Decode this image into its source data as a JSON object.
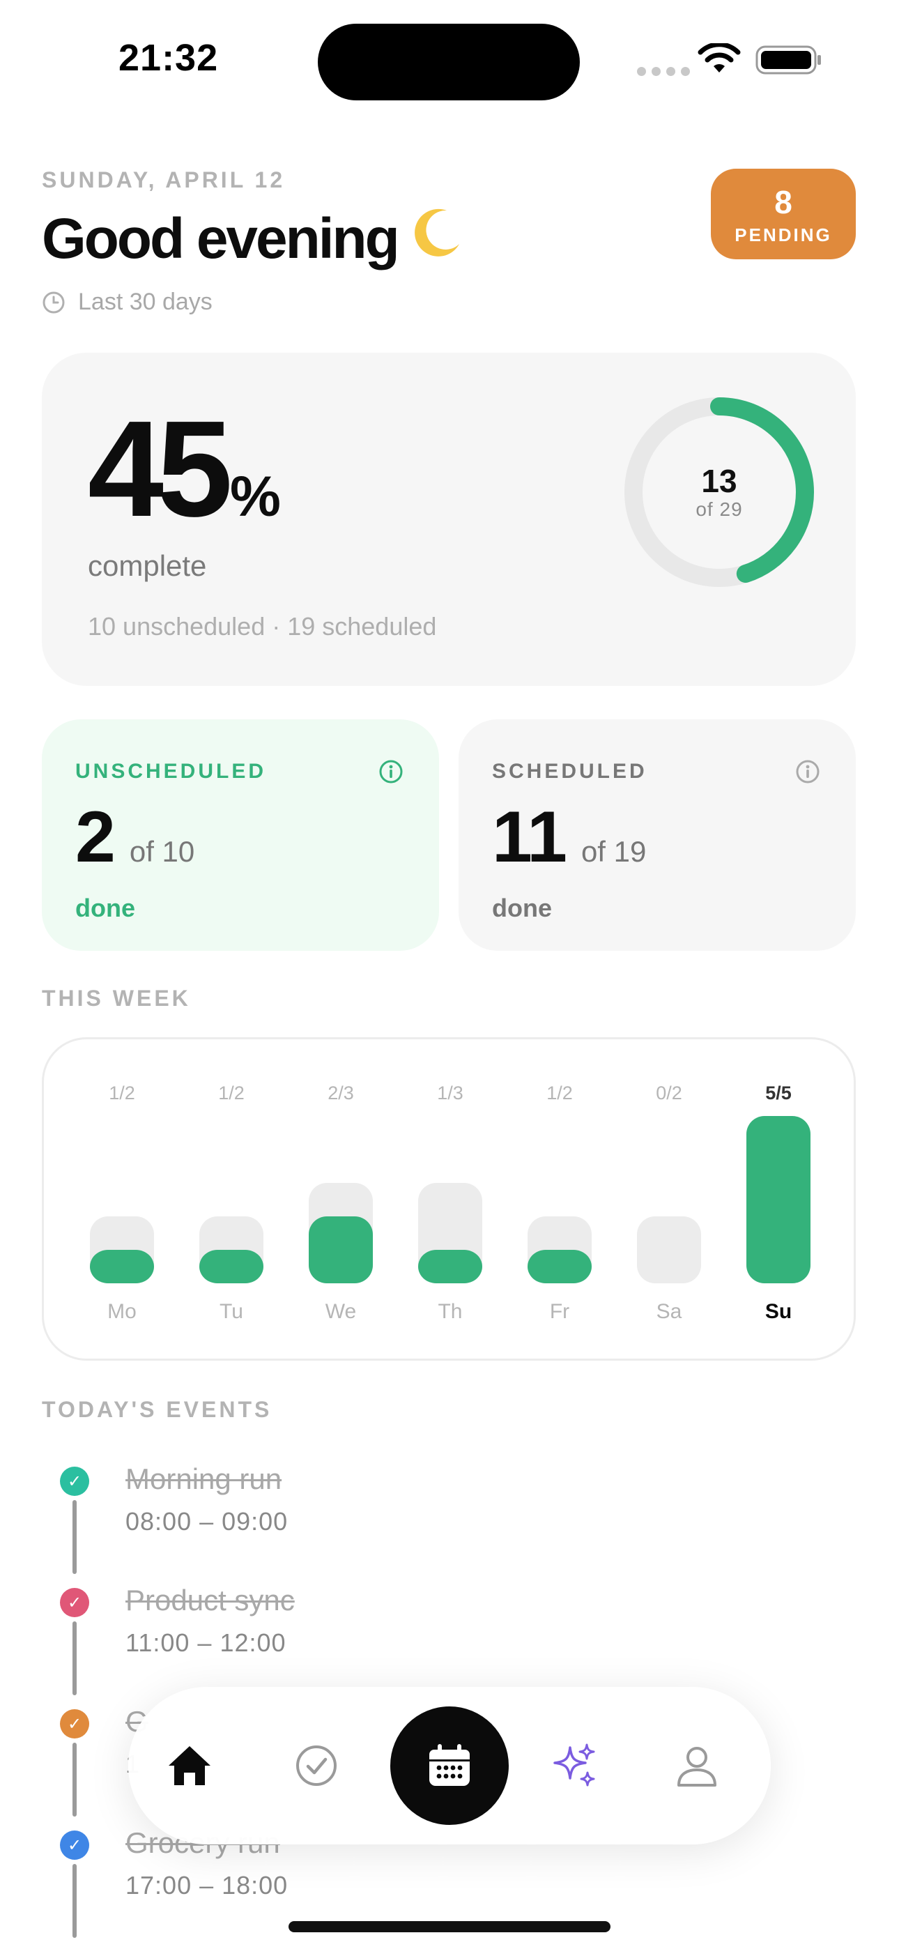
{
  "status_bar": {
    "time": "21:32"
  },
  "header": {
    "date": "SUNDAY, APRIL 12",
    "greeting": "Good evening",
    "range": "Last 30 days",
    "pending_count": "8",
    "pending_label": "PENDING"
  },
  "progress": {
    "percent": "45",
    "percent_sign": "%",
    "complete_label": "complete",
    "breakdown": "10 unscheduled  ·  19 scheduled",
    "ring_done": "13",
    "ring_total": "of 29",
    "ring_fraction": 0.45,
    "color": "#34b27b"
  },
  "stats": {
    "unscheduled": {
      "title": "UNSCHEDULED",
      "value": "2",
      "of": "of 10",
      "done": "done",
      "accent": "#34b27b"
    },
    "scheduled": {
      "title": "SCHEDULED",
      "value": "11",
      "of": "of 19",
      "done": "done",
      "accent": "#777777"
    }
  },
  "week": {
    "label": "THIS WEEK",
    "days": [
      {
        "day": "Mo",
        "label": "1/2",
        "done": 1,
        "total": 2,
        "today": false
      },
      {
        "day": "Tu",
        "label": "1/2",
        "done": 1,
        "total": 2,
        "today": false
      },
      {
        "day": "We",
        "label": "2/3",
        "done": 2,
        "total": 3,
        "today": false
      },
      {
        "day": "Th",
        "label": "1/3",
        "done": 1,
        "total": 3,
        "today": false
      },
      {
        "day": "Fr",
        "label": "1/2",
        "done": 1,
        "total": 2,
        "today": false
      },
      {
        "day": "Sa",
        "label": "0/2",
        "done": 0,
        "total": 2,
        "today": false
      },
      {
        "day": "Su",
        "label": "5/5",
        "done": 5,
        "total": 5,
        "today": true
      }
    ]
  },
  "events": {
    "label": "TODAY'S EVENTS",
    "items": [
      {
        "title": "Morning run",
        "time": "08:00 – 09:00",
        "color": "#2bbfa0"
      },
      {
        "title": "Product sync",
        "time": "11:00 – 12:00",
        "color": "#e05777"
      },
      {
        "title": "G",
        "time": "1",
        "color": "#e08a3c"
      },
      {
        "title": "Grocery run",
        "time": "17:00 – 18:00",
        "color": "#3f86e6"
      }
    ]
  },
  "nav": {
    "items": [
      "home-icon",
      "check-circle-icon",
      "calendar-icon",
      "sparkles-icon",
      "person-icon"
    ]
  }
}
